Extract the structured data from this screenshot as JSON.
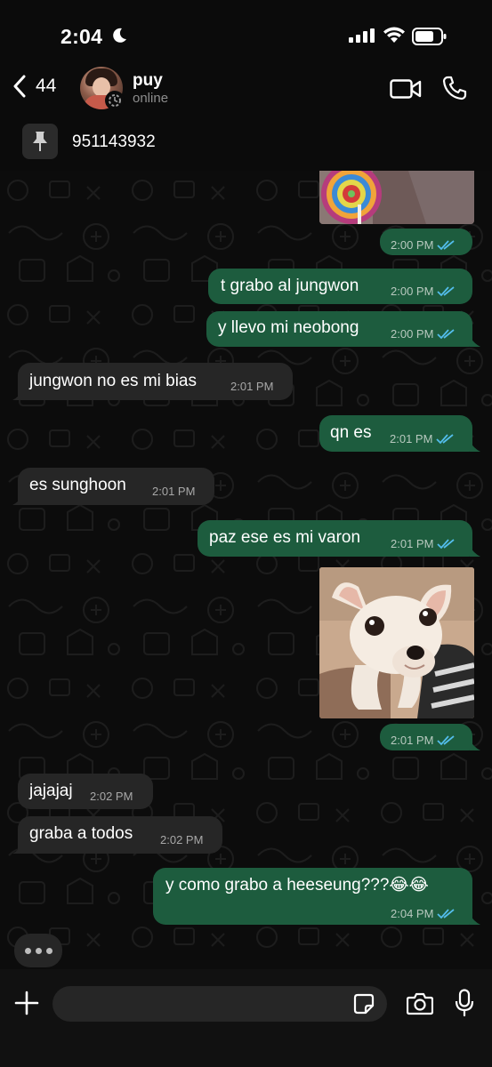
{
  "status_bar": {
    "time": "2:04"
  },
  "header": {
    "back_count": "44",
    "contact_name": "puy",
    "contact_status": "online",
    "pinned_text": "951143932"
  },
  "messages": [
    {
      "dir": "out",
      "kind": "image",
      "subject": "lollipop photo",
      "time": "2:00 PM"
    },
    {
      "dir": "out",
      "text": "t grabo al jungwon",
      "time": "2:00 PM"
    },
    {
      "dir": "out",
      "text": "y llevo mi neobong",
      "time": "2:00 PM"
    },
    {
      "dir": "in",
      "text": "jungwon no es mi bias",
      "time": "2:01 PM"
    },
    {
      "dir": "out",
      "text": "qn es",
      "time": "2:01 PM"
    },
    {
      "dir": "in",
      "text": "es sunghoon",
      "time": "2:01 PM"
    },
    {
      "dir": "out",
      "text": "paz ese es mi varon",
      "time": "2:01 PM"
    },
    {
      "dir": "out",
      "kind": "image",
      "subject": "chihuahua photo",
      "time": "2:01 PM"
    },
    {
      "dir": "in",
      "text": "jajajaj",
      "time": "2:02 PM"
    },
    {
      "dir": "in",
      "text": "graba a todos",
      "time": "2:02 PM"
    },
    {
      "dir": "out",
      "text": "y como grabo a heeseung???😂😂",
      "time": "2:04 PM"
    }
  ],
  "composer": {
    "placeholder": ""
  },
  "colors": {
    "outgoing_bubble": "#1d5c3e",
    "incoming_bubble": "#262626",
    "read_ticks": "#53bdeb",
    "background": "#0b0b0b"
  }
}
